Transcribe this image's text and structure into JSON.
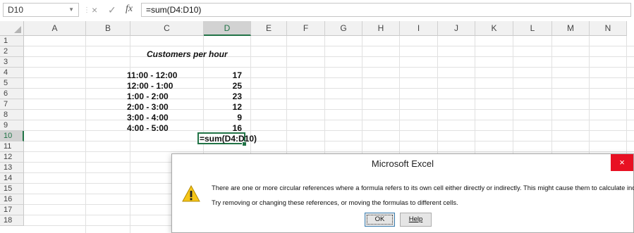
{
  "formula_bar": {
    "name_box": "D10",
    "cancel_glyph": "×",
    "enter_glyph": "✓",
    "fx_label": "fx",
    "formula": "=sum(D4:D10)"
  },
  "grid": {
    "columns": [
      "A",
      "B",
      "C",
      "D",
      "E",
      "F",
      "G",
      "H",
      "I",
      "J",
      "K",
      "L",
      "M",
      "N"
    ],
    "selected_column": "D",
    "rows": [
      "1",
      "2",
      "3",
      "4",
      "5",
      "6",
      "7",
      "8",
      "9",
      "10",
      "11",
      "12",
      "13",
      "14",
      "15",
      "16",
      "17",
      "18"
    ],
    "selected_row": "10"
  },
  "sheet": {
    "title": "Customers per hour",
    "entries": [
      {
        "time": "11:00 - 12:00",
        "value": "17"
      },
      {
        "time": "12:00 - 1:00",
        "value": "25"
      },
      {
        "time": "1:00 - 2:00",
        "value": "23"
      },
      {
        "time": "2:00 - 3:00",
        "value": "12"
      },
      {
        "time": "3:00 - 4:00",
        "value": "9"
      },
      {
        "time": "4:00 - 5:00",
        "value": "16"
      }
    ],
    "active_cell_text": "=sum(D4:D10)"
  },
  "dialog": {
    "title": "Microsoft Excel",
    "close_glyph": "×",
    "icon": "warning-icon",
    "message_line1": "There are one or more circular references where a formula refers to its own cell either directly or indirectly. This might cause them to calculate incorrectly.",
    "message_line2": "Try removing or changing these references, or moving the formulas to different cells.",
    "ok_label": "OK",
    "help_label": "Help"
  },
  "colors": {
    "excel_green": "#217346",
    "close_red": "#e81123",
    "warning_yellow": "#f5c518"
  }
}
